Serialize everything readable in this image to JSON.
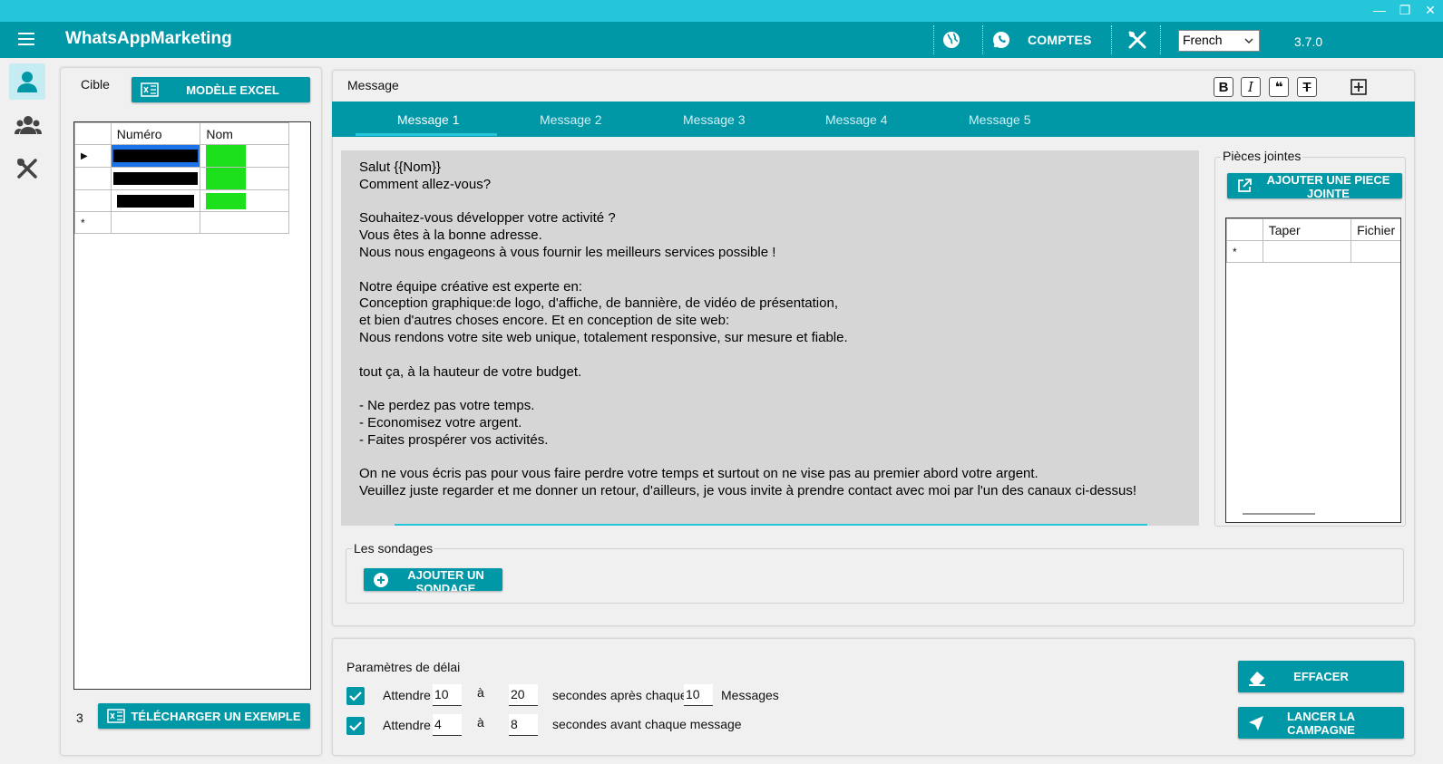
{
  "app": {
    "title": "WhatsAppMarketing",
    "accounts_label": "COMPTES",
    "language": "French",
    "version": "3.7.0"
  },
  "target": {
    "label": "Cible",
    "excel_button": "MODÈLE EXCEL",
    "columns": [
      "Numéro",
      "Nom"
    ],
    "count": "3",
    "download_button": "TÉLÉCHARGER UN EXEMPLE",
    "new_row_marker": "*"
  },
  "message": {
    "label": "Message",
    "tabs": [
      "Message 1",
      "Message 2",
      "Message 3",
      "Message 4",
      "Message 5"
    ],
    "text": "Salut {{Nom}}\nComment allez-vous?\n\nSouhaitez-vous développer votre activité ?\nVous êtes à la bonne adresse.\nNous nous engageons à vous fournir les meilleurs services possible !\n\nNotre équipe créative est experte en:\nConception graphique:de logo, d'affiche, de bannière, de vidéo de présentation,\net bien d'autres choses encore. Et en conception de site web:\nNous rendons votre site web unique, totalement responsive, sur mesure et fiable.\n\ntout ça, à la hauteur de votre budget.\n\n- Ne perdez pas votre temps.\n- Economisez votre argent.\n- Faites prospérer vos activités.\n\nOn ne vous écris pas pour vous faire perdre votre temps et surtout on ne vise pas au premier abord votre argent.\nVeuillez juste regarder et me donner un retour, d'ailleurs, je vous invite à prendre contact avec moi par l'un des canaux ci-dessus!"
  },
  "attachments": {
    "label": "Pièces jointes",
    "add_button": "AJOUTER UNE PIECE JOINTE",
    "columns": [
      "Taper",
      "Fichier"
    ],
    "new_row_marker": "*"
  },
  "polls": {
    "label": "Les sondages",
    "add_button": "AJOUTER UN SONDAGE"
  },
  "delay": {
    "label": "Paramètres de délai",
    "row1": {
      "wait": "Attendre",
      "from": "10",
      "to_word": "à",
      "to": "20",
      "after": "secondes après chaque",
      "count": "10",
      "unit": "Messages"
    },
    "row2": {
      "wait": "Attendre",
      "from": "4",
      "to_word": "à",
      "to": "8",
      "after": "secondes avant chaque message"
    }
  },
  "actions": {
    "clear": "EFFACER",
    "launch": "LANCER LA CAMPAGNE"
  }
}
